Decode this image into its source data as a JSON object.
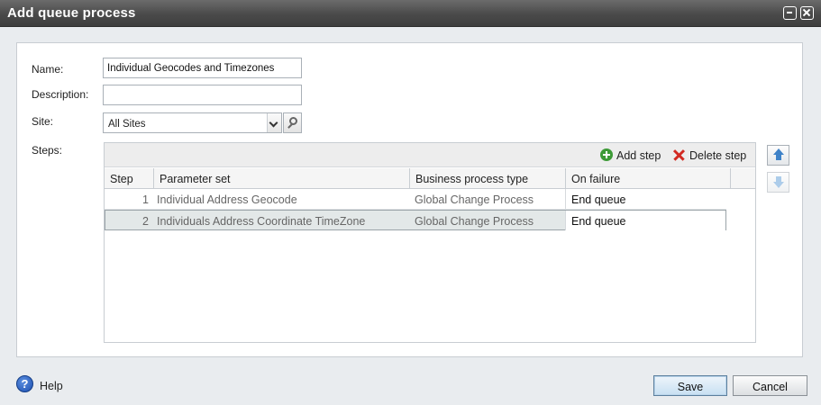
{
  "dialog": {
    "title": "Add queue process"
  },
  "form": {
    "name_label": "Name:",
    "name_value": "Individual Geocodes and Timezones",
    "description_label": "Description:",
    "description_value": "",
    "site_label": "Site:",
    "site_value": "All Sites",
    "steps_label": "Steps:"
  },
  "steps_toolbar": {
    "add_label": "Add step",
    "delete_label": "Delete step"
  },
  "steps_table": {
    "columns": [
      "Step",
      "Parameter set",
      "Business process type",
      "On failure"
    ],
    "rows": [
      {
        "step": "1",
        "parameter_set": "Individual Address Geocode",
        "process_type": "Global Change Process",
        "on_failure": "End queue"
      },
      {
        "step": "2",
        "parameter_set": "Individuals Address Coordinate TimeZone",
        "process_type": "Global Change Process",
        "on_failure": "End queue"
      }
    ],
    "selected_row": 2
  },
  "footer": {
    "help_label": "Help",
    "save_label": "Save",
    "cancel_label": "Cancel"
  },
  "icons": {
    "restore": "restore-icon",
    "close": "close-icon",
    "dropdown": "chevron-down-icon",
    "lookup": "search-icon",
    "add": "add-icon",
    "delete": "delete-icon",
    "move_up": "arrow-up-icon",
    "move_down": "arrow-down-icon",
    "help": "help-icon"
  },
  "colors": {
    "titlebar": "#4a4a4a",
    "add_icon": "#3d9a37",
    "delete_icon": "#d22a22",
    "arrow_icon": "#3e82c8"
  }
}
